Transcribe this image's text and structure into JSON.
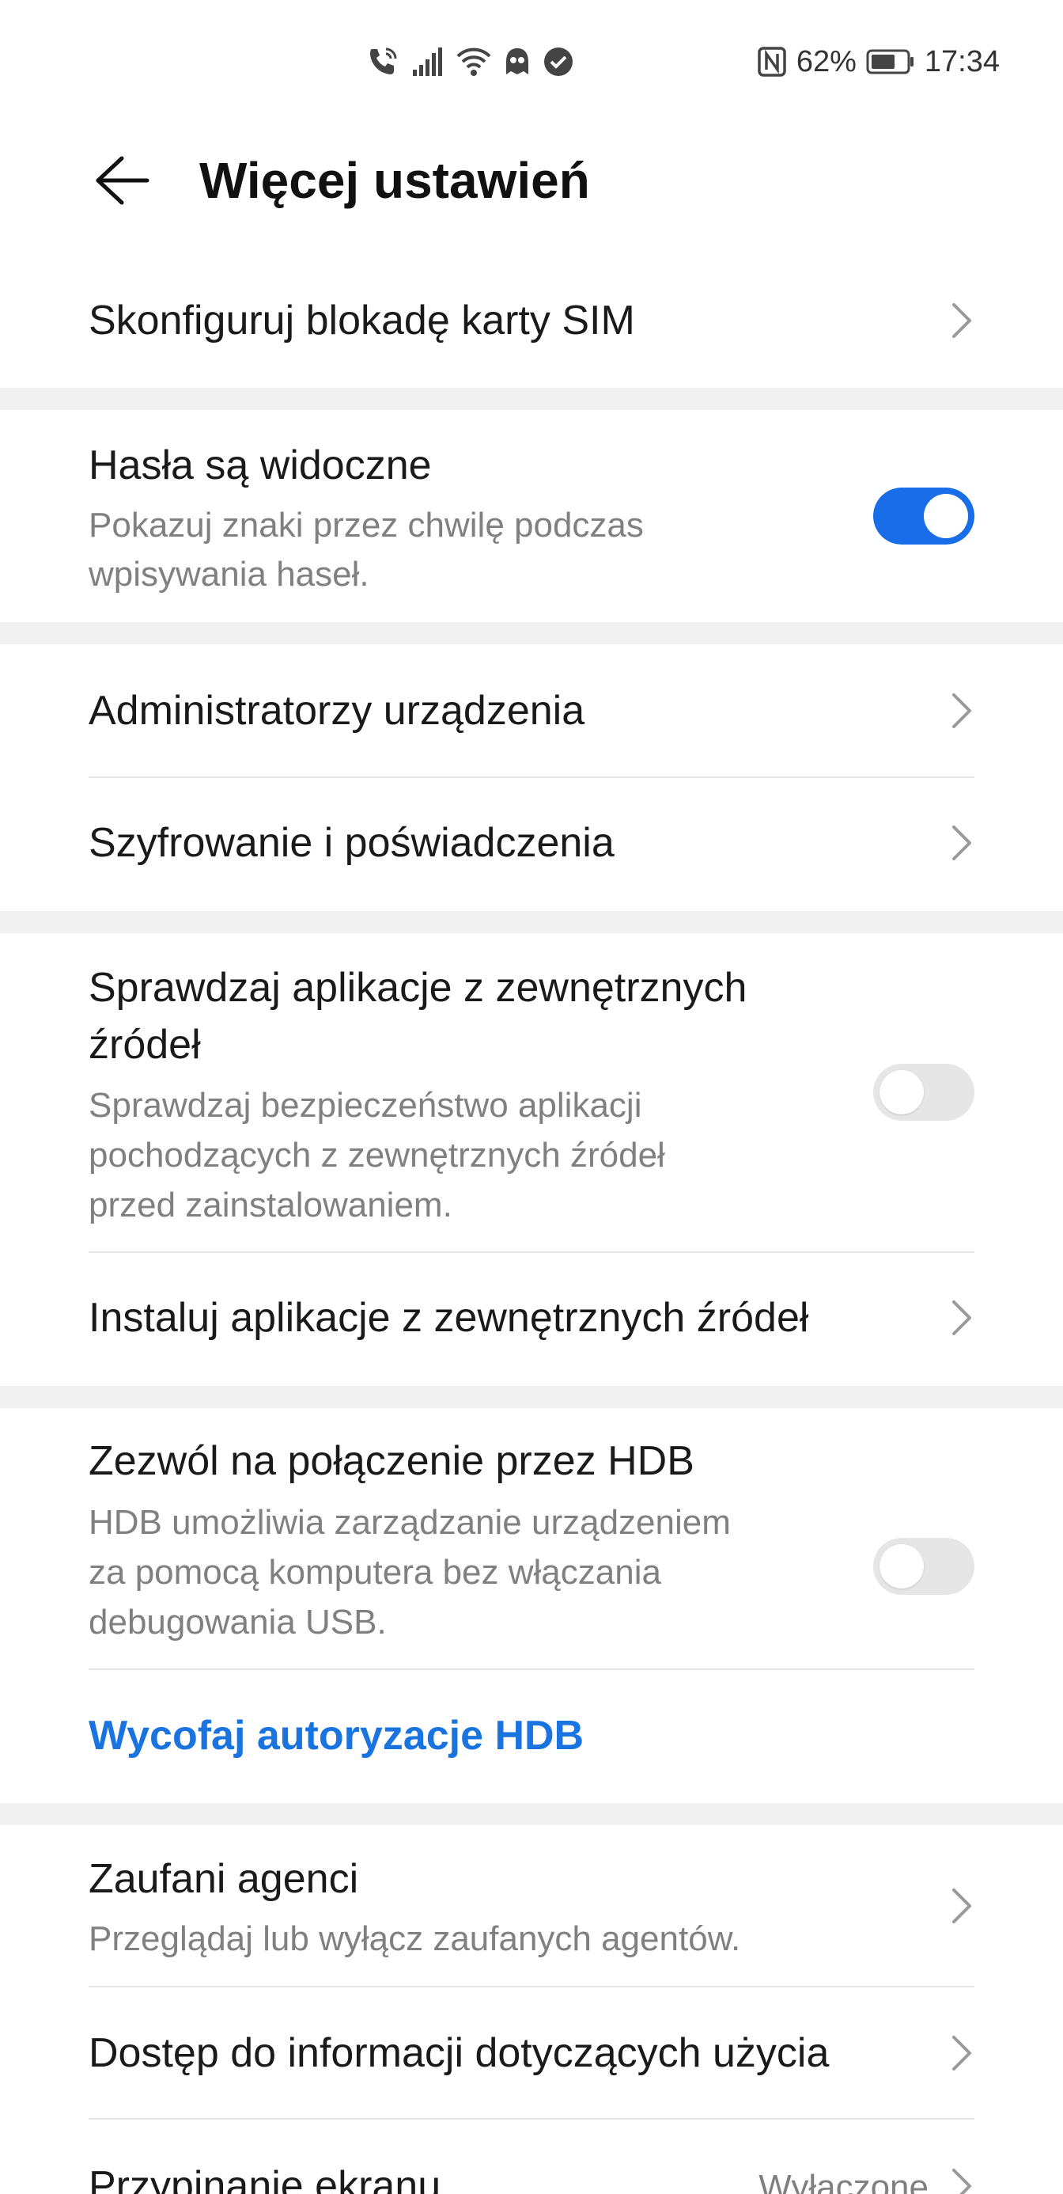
{
  "status_bar": {
    "nfc_icon": "nfc-icon",
    "battery_percent": "62%",
    "time": "17:34"
  },
  "header": {
    "title": "Więcej ustawień"
  },
  "rows": {
    "sim_lock": {
      "title": "Skonfiguruj blokadę karty SIM"
    },
    "passwords_visible": {
      "title": "Hasła są widoczne",
      "subtitle_line1": "Pokazuj znaki przez chwilę podczas",
      "subtitle_line2": "wpisywania haseł.",
      "enabled": true
    },
    "device_admins": {
      "title": "Administratorzy urządzenia"
    },
    "encryption": {
      "title": "Szyfrowanie i poświadczenia"
    },
    "check_external_apps": {
      "title_line1": "Sprawdzaj aplikacje z zewnętrznych",
      "title_line2": "źródeł",
      "subtitle_line1": "Sprawdzaj bezpieczeństwo aplikacji",
      "subtitle_line2": "pochodzących z zewnętrznych źródeł",
      "subtitle_line3": "przed zainstalowaniem.",
      "enabled": false
    },
    "install_external_apps": {
      "title": "Instaluj aplikacje z zewnętrznych źródeł"
    },
    "hdb": {
      "title": "Zezwól na połączenie przez HDB",
      "subtitle_line1": "HDB umożliwia zarządzanie urządzeniem",
      "subtitle_line2": "za pomocą komputera bez włączania",
      "subtitle_line3": "debugowania USB.",
      "enabled": false
    },
    "revoke_hdb": {
      "label": "Wycofaj autoryzacje HDB"
    },
    "trusted_agents": {
      "title": "Zaufani agenci",
      "subtitle": "Przeglądaj lub wyłącz zaufanych agentów."
    },
    "usage_access": {
      "title": "Dostęp do informacji dotyczących użycia"
    },
    "screen_pinning": {
      "title": "Przypinanie ekranu",
      "value": "Wyłączone"
    }
  },
  "colors": {
    "accent": "#1a6de8",
    "link": "#1a74e0",
    "section_gap": "#f1f1f1",
    "secondary_text": "#808080"
  }
}
